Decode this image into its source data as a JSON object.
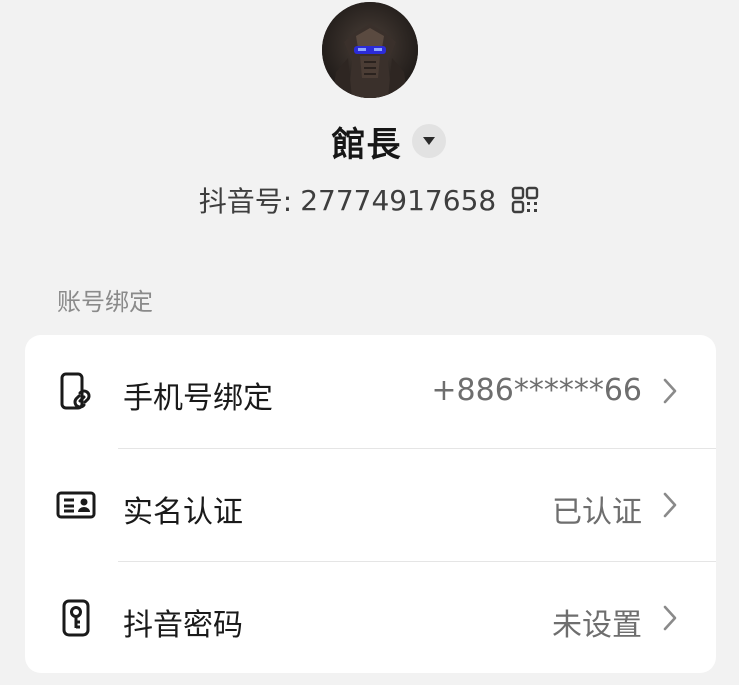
{
  "profile": {
    "username": "館長",
    "douyin_id_label": "抖音号:",
    "douyin_id": "27774917658"
  },
  "account_binding": {
    "section_title": "账号绑定",
    "items": [
      {
        "label": "手机号绑定",
        "value": "+886******66",
        "icon": "phone-link-icon"
      },
      {
        "label": "实名认证",
        "value": "已认证",
        "icon": "id-card-icon"
      },
      {
        "label": "抖音密码",
        "value": "未设置",
        "icon": "key-icon"
      }
    ]
  },
  "colors": {
    "background": "#f2f2f2",
    "card": "#ffffff",
    "primary_text": "#1a1a1a",
    "secondary_text": "#6e6e6e",
    "section_title": "#8a8a8a"
  }
}
